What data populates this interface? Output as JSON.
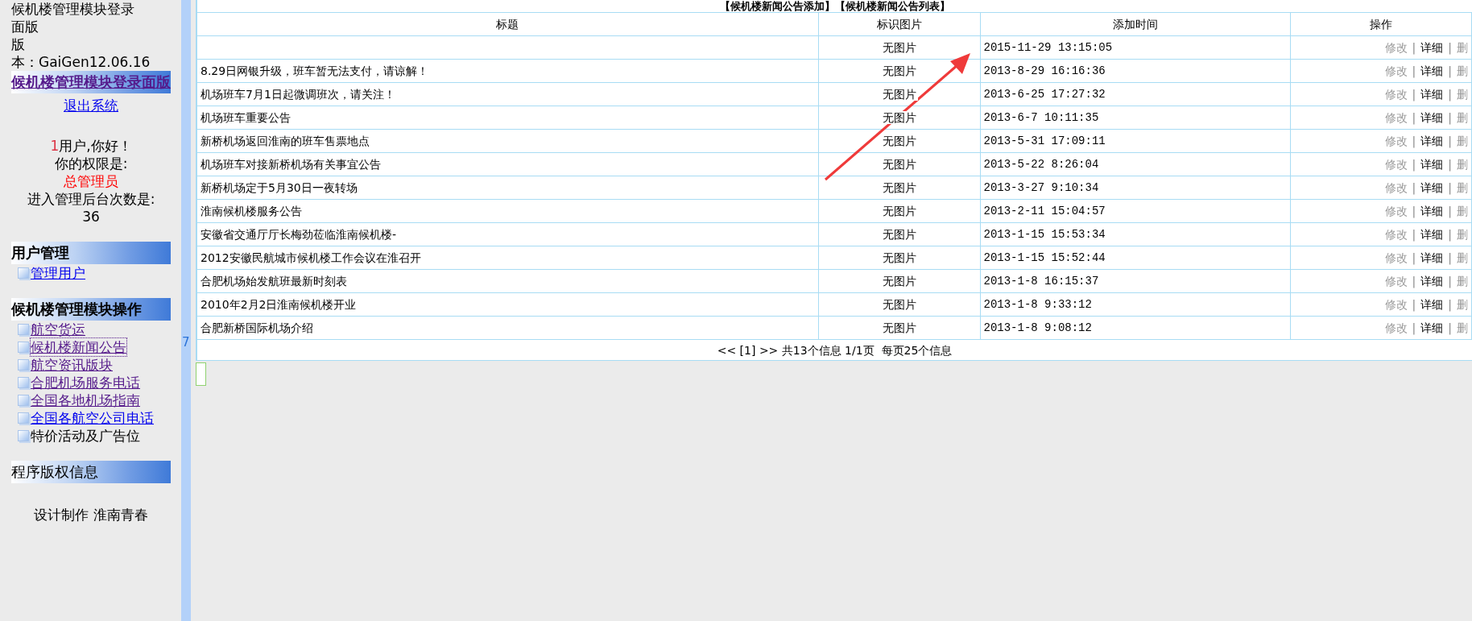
{
  "sidebar": {
    "version_lines": [
      "候机楼管理模块登录",
      "面版",
      "版",
      "本：GaiGen12.06.16"
    ],
    "title_link": {
      "label": "候机楼管理模块登录面版",
      "visited": true
    },
    "logout_link": {
      "label": "退出系统",
      "visited": false
    },
    "greeting": {
      "count": "1",
      "text": "用户,你好！"
    },
    "permission_label": "你的权限是:",
    "role": "总管理员",
    "visits_label": "进入管理后台次数是:",
    "visits": "36",
    "sections": [
      {
        "title": "用户管理",
        "bold": true,
        "items": [
          {
            "label": "管理用户",
            "kind": "link",
            "visited": false,
            "focused": false
          }
        ]
      },
      {
        "title": "候机楼管理模块操作",
        "bold": true,
        "items": [
          {
            "label": "航空货运",
            "kind": "link",
            "visited": true,
            "focused": false
          },
          {
            "label": "候机楼新闻公告",
            "kind": "link",
            "visited": true,
            "focused": true
          },
          {
            "label": "航空资讯版块",
            "kind": "link",
            "visited": true,
            "focused": false
          },
          {
            "label": "合肥机场服务电话",
            "kind": "link",
            "visited": true,
            "focused": false
          },
          {
            "label": "全国各地机场指南",
            "kind": "link",
            "visited": true,
            "focused": false
          },
          {
            "label": "全国各航空公司电话",
            "kind": "link",
            "visited": false,
            "focused": false
          },
          {
            "label": "特价活动及广告位",
            "kind": "text"
          }
        ]
      },
      {
        "title": "程序版权信息",
        "bold": false,
        "items": [
          {
            "label": "设计制作 淮南青春",
            "kind": "credit"
          }
        ]
      }
    ]
  },
  "splitter": {
    "label": "7"
  },
  "main": {
    "heading_links": [
      "【候机楼新闻公告添加】",
      "【候机楼新闻公告列表】"
    ],
    "columns": [
      "标题",
      "标识图片",
      "添加时间",
      "操作"
    ],
    "rows": [
      {
        "image": "无图片",
        "time": "2015-11-29 13:15:05",
        "actions": [
          {
            "kind": "link",
            "label": "修改",
            "disabled": true
          },
          {
            "kind": "separator",
            "label": "|"
          },
          {
            "kind": "link",
            "label": "详细",
            "disabled": false
          },
          {
            "kind": "separator",
            "label": "|"
          },
          {
            "kind": "link",
            "label": "删",
            "disabled": true
          }
        ]
      },
      {
        "title": "8.29日网银升级，班车暂无法支付，请谅解！",
        "image": "无图片",
        "time": "2013-8-29 16:16:36",
        "actions": [
          {
            "kind": "link",
            "label": "修改",
            "disabled": true
          },
          {
            "kind": "separator",
            "label": "|"
          },
          {
            "kind": "link",
            "label": "详细",
            "disabled": false
          },
          {
            "kind": "separator",
            "label": "|"
          },
          {
            "kind": "link",
            "label": "删",
            "disabled": true
          }
        ]
      },
      {
        "title": "机场班车7月1日起微调班次，请关注！",
        "image": "无图片",
        "time": "2013-6-25 17:27:32",
        "actions": [
          {
            "kind": "link",
            "label": "修改",
            "disabled": true
          },
          {
            "kind": "separator",
            "label": "|"
          },
          {
            "kind": "link",
            "label": "详细",
            "disabled": false
          },
          {
            "kind": "separator",
            "label": "|"
          },
          {
            "kind": "link",
            "label": "删",
            "disabled": true
          }
        ]
      },
      {
        "title": "机场班车重要公告",
        "image": "无图片",
        "time": "2013-6-7 10:11:35",
        "actions": [
          {
            "kind": "link",
            "label": "修改",
            "disabled": true
          },
          {
            "kind": "separator",
            "label": "|"
          },
          {
            "kind": "link",
            "label": "详细",
            "disabled": false
          },
          {
            "kind": "separator",
            "label": "|"
          },
          {
            "kind": "link",
            "label": "删",
            "disabled": true
          }
        ]
      },
      {
        "title": "新桥机场返回淮南的班车售票地点",
        "image": "无图片",
        "time": "2013-5-31 17:09:11",
        "actions": [
          {
            "kind": "link",
            "label": "修改",
            "disabled": true
          },
          {
            "kind": "separator",
            "label": "|"
          },
          {
            "kind": "link",
            "label": "详细",
            "disabled": false
          },
          {
            "kind": "separator",
            "label": "|"
          },
          {
            "kind": "link",
            "label": "删",
            "disabled": true
          }
        ]
      },
      {
        "title": "机场班车对接新桥机场有关事宜公告",
        "image": "无图片",
        "time": "2013-5-22 8:26:04",
        "actions": [
          {
            "kind": "link",
            "label": "修改",
            "disabled": true
          },
          {
            "kind": "separator",
            "label": "|"
          },
          {
            "kind": "link",
            "label": "详细",
            "disabled": false
          },
          {
            "kind": "separator",
            "label": "|"
          },
          {
            "kind": "link",
            "label": "删",
            "disabled": true
          }
        ]
      },
      {
        "title": "新桥机场定于5月30日一夜转场",
        "image": "无图片",
        "time": "2013-3-27 9:10:34",
        "actions": [
          {
            "kind": "link",
            "label": "修改",
            "disabled": true
          },
          {
            "kind": "separator",
            "label": "|"
          },
          {
            "kind": "link",
            "label": "详细",
            "disabled": false
          },
          {
            "kind": "separator",
            "label": "|"
          },
          {
            "kind": "link",
            "label": "删",
            "disabled": true
          }
        ]
      },
      {
        "title": "淮南候机楼服务公告",
        "image": "无图片",
        "time": "2013-2-11 15:04:57",
        "actions": [
          {
            "kind": "link",
            "label": "修改",
            "disabled": true
          },
          {
            "kind": "separator",
            "label": "|"
          },
          {
            "kind": "link",
            "label": "详细",
            "disabled": false
          },
          {
            "kind": "separator",
            "label": "|"
          },
          {
            "kind": "link",
            "label": "删",
            "disabled": true
          }
        ]
      },
      {
        "title": "安徽省交通厅厅长梅劲莅临淮南候机楼-",
        "image": "无图片",
        "time": "2013-1-15 15:53:34",
        "actions": [
          {
            "kind": "link",
            "label": "修改",
            "disabled": true
          },
          {
            "kind": "separator",
            "label": "|"
          },
          {
            "kind": "link",
            "label": "详细",
            "disabled": false
          },
          {
            "kind": "separator",
            "label": "|"
          },
          {
            "kind": "link",
            "label": "删",
            "disabled": true
          }
        ]
      },
      {
        "title": "2012安徽民航城市候机楼工作会议在淮召开",
        "image": "无图片",
        "time": "2013-1-15 15:52:44",
        "actions": [
          {
            "kind": "link",
            "label": "修改",
            "disabled": true
          },
          {
            "kind": "separator",
            "label": "|"
          },
          {
            "kind": "link",
            "label": "详细",
            "disabled": false
          },
          {
            "kind": "separator",
            "label": "|"
          },
          {
            "kind": "link",
            "label": "删",
            "disabled": true
          }
        ]
      },
      {
        "title": "合肥机场始发航班最新时刻表",
        "image": "无图片",
        "time": "2013-1-8 16:15:37",
        "actions": [
          {
            "kind": "link",
            "label": "修改",
            "disabled": true
          },
          {
            "kind": "separator",
            "label": "|"
          },
          {
            "kind": "link",
            "label": "详细",
            "disabled": false
          },
          {
            "kind": "separator",
            "label": "|"
          },
          {
            "kind": "link",
            "label": "删",
            "disabled": true
          }
        ]
      },
      {
        "title": "2010年2月2日淮南候机楼开业",
        "image": "无图片",
        "time": "2013-1-8 9:33:12",
        "actions": [
          {
            "kind": "link",
            "label": "修改",
            "disabled": true
          },
          {
            "kind": "separator",
            "label": "|"
          },
          {
            "kind": "link",
            "label": "详细",
            "disabled": false
          },
          {
            "kind": "separator",
            "label": "|"
          },
          {
            "kind": "link",
            "label": "删",
            "disabled": true
          }
        ]
      },
      {
        "title": "合肥新桥国际机场介绍",
        "image": "无图片",
        "time": "2013-1-8 9:08:12",
        "actions": [
          {
            "kind": "link",
            "label": "修改",
            "disabled": true
          },
          {
            "kind": "separator",
            "label": "|"
          },
          {
            "kind": "link",
            "label": "详细",
            "disabled": false
          },
          {
            "kind": "separator",
            "label": "|"
          },
          {
            "kind": "link",
            "label": "删",
            "disabled": true
          }
        ]
      }
    ],
    "pagination": {
      "prev": "<<",
      "page": "[1]",
      "next": ">>",
      "summary": "共13个信息 1/1页",
      "per_page": "每页25个信息"
    }
  }
}
